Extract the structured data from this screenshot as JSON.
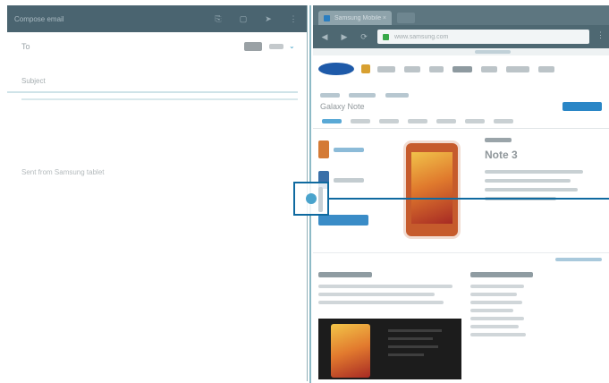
{
  "email": {
    "title": "Compose email",
    "to_label": "To",
    "subject_label": "Subject",
    "signature": "Sent from Samsung tablet",
    "toolbar_icons": [
      "attach-icon",
      "save-icon",
      "send-icon",
      "more-icon"
    ],
    "chevron": "⌄"
  },
  "browser": {
    "tab_title": "Samsung Mobile",
    "tab_close": "×",
    "url": "www.samsung.com",
    "menu_glyph": "⋮",
    "nav_back": "◀",
    "nav_forward": "▶",
    "nav_refresh": "⟳",
    "product_name": "Galaxy Note",
    "headline": "Note 3"
  },
  "colors": {
    "toolbar": "#4a6470",
    "divider": "#8dbac6",
    "callout": "#0f6aa0",
    "handle": "#4aa3cc"
  },
  "icons": {
    "attach": "⎘",
    "save": "▢",
    "send": "➤",
    "more": "⋮"
  }
}
